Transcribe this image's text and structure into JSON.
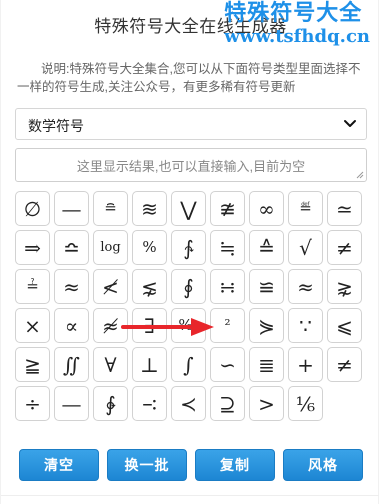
{
  "header": {
    "title": "特殊符号大全在线生成器",
    "watermark_name": "特殊符号大全",
    "watermark_url": "www.tsfhdq.cn"
  },
  "description": "说明:特殊符号大全集合,您可以从下面符号类型里面选择不一样的符号生成,关注公众号，有更多稀有符号更新",
  "select": {
    "value": "数学符号"
  },
  "output": {
    "placeholder": "这里显示结果,也可以直接输入,目前为空"
  },
  "symbols": [
    "∅",
    "—",
    "≘",
    "≋",
    "⋁",
    "≇",
    "∞",
    "≝",
    "≃",
    "⇒",
    "≏",
    "log",
    "%",
    "∱",
    "≒",
    "≙",
    "√",
    "≠",
    "≟",
    "≈",
    "≮",
    "⋦",
    "∮",
    "∺",
    "≌",
    "≈",
    "⋧",
    "×",
    "∝",
    "≉",
    "∃",
    "‰",
    "²",
    "⋟",
    "∵",
    "⩽",
    "≧",
    "∬",
    "∀",
    "⊥",
    "∫",
    "∽",
    "≣",
    "+",
    "≠",
    "÷",
    "—",
    "∲",
    "∹",
    "≺",
    "⊇",
    ">",
    "⅙"
  ],
  "buttons": {
    "clear": "清空",
    "shuffle": "换一批",
    "copy": "复制",
    "style": "风格"
  },
  "colors": {
    "accent": "#1e90e8",
    "arrow": "#e8262b"
  }
}
